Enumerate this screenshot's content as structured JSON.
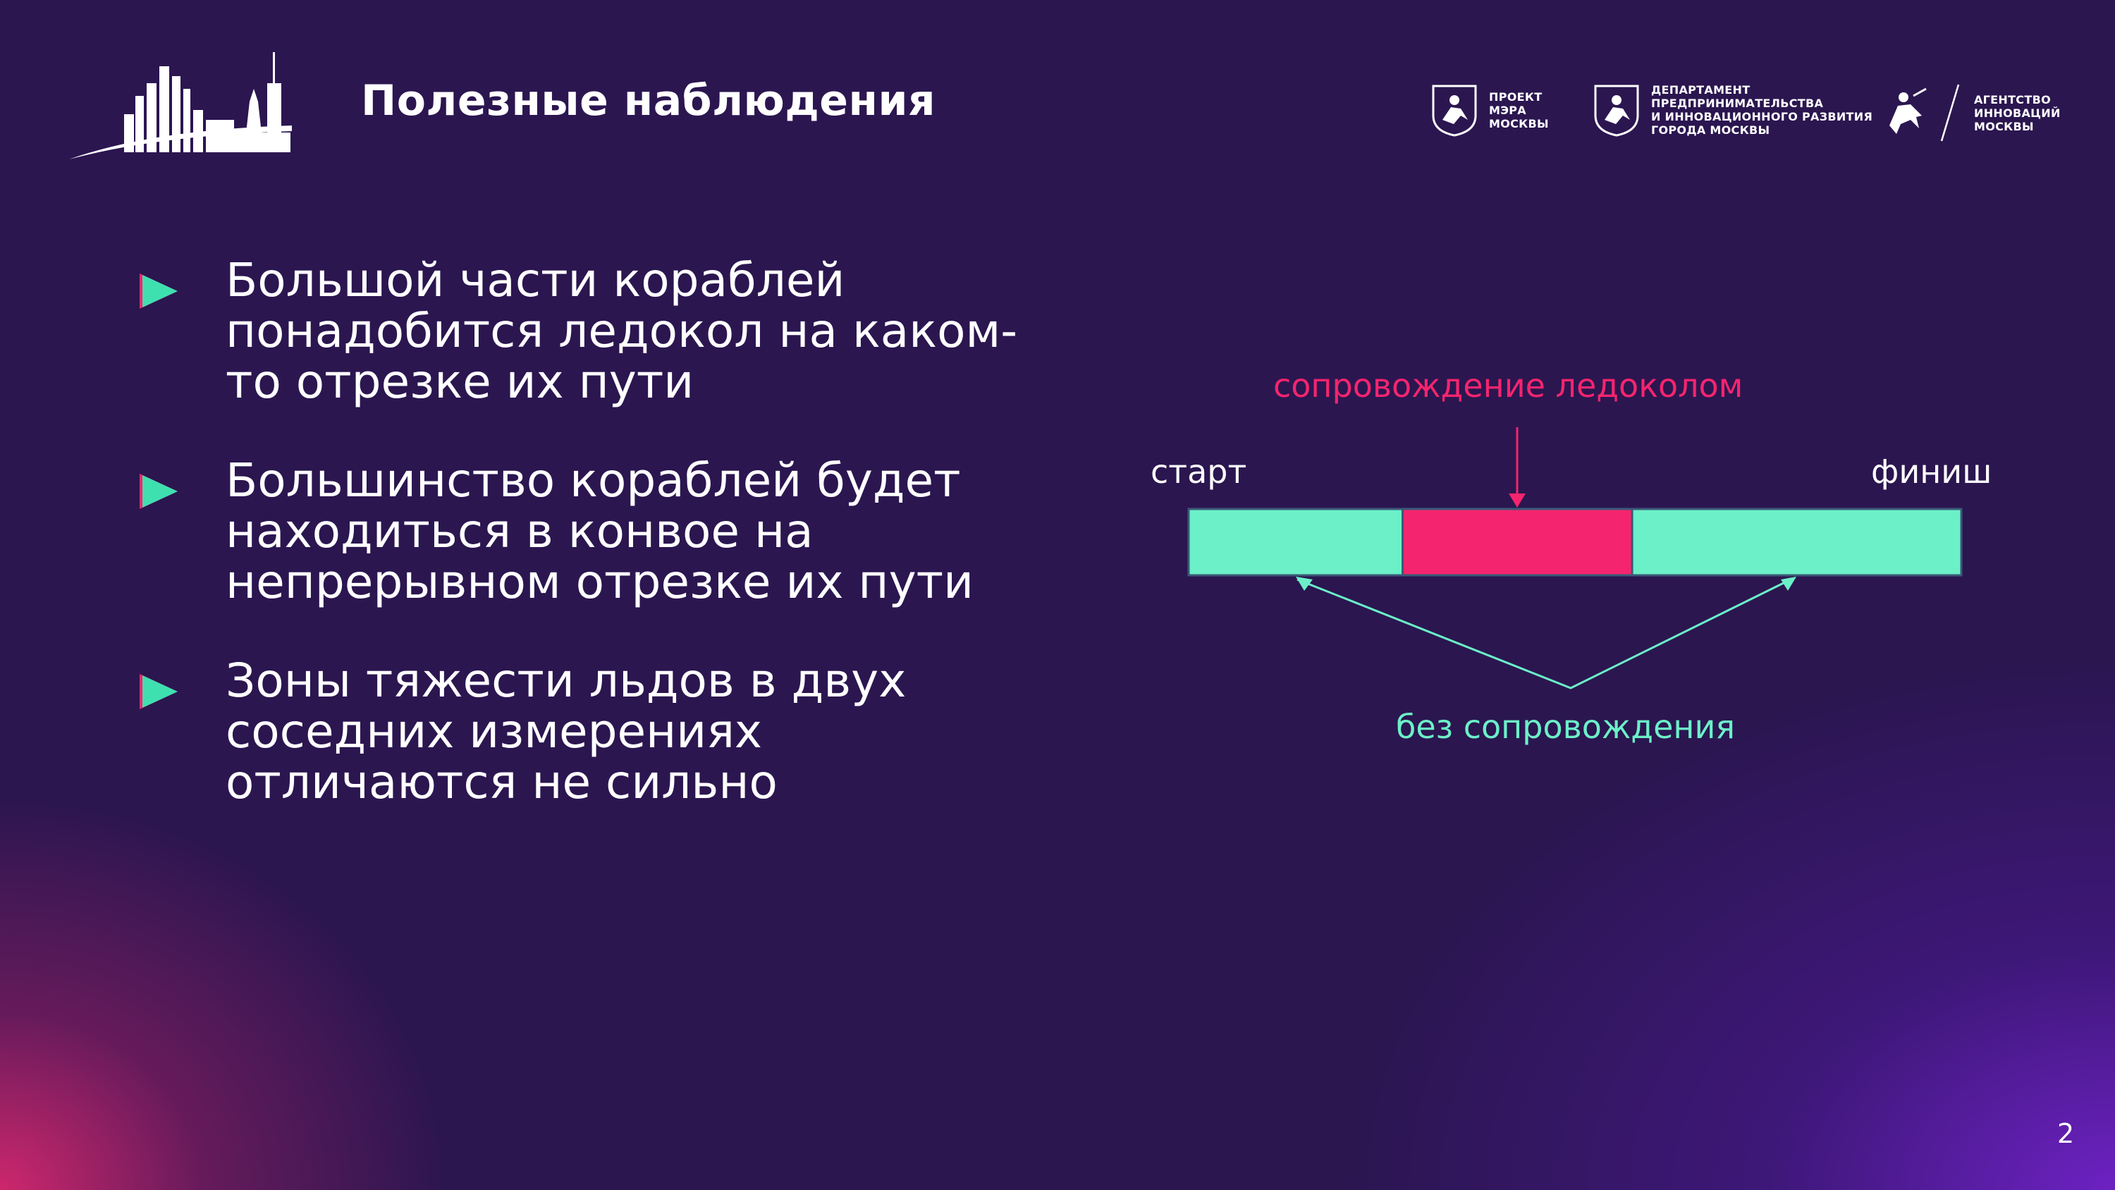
{
  "slide": {
    "title": "Полезные наблюдения",
    "page_number": "2"
  },
  "logos": [
    {
      "icon": "moscow-emblem-icon",
      "text": "ПРОЕКТ\nМЭРА\nМОСКВЫ"
    },
    {
      "icon": "moscow-emblem-icon",
      "text": "ДЕПАРТАМЕНТ\nПРЕДПРИНИМАТЕЛЬСТВА\nИ ИННОВАЦИОННОГО РАЗВИТИЯ\nГОРОДА МОСКВЫ"
    },
    {
      "icon": "st-george-icon",
      "text": "АГЕНТСТВО\nИННОВАЦИЙ\nМОСКВЫ"
    }
  ],
  "bullets": [
    "Большой части кораблей\nпонадобится ледокол на каком-\nто отрезке их пути",
    "Большинство кораблей будет\nнаходиться в конвое на\nнепрерывном отрезке их пути",
    "Зоны тяжести льдов в двух\nсоседних измерениях\nотличаются не сильно"
  ],
  "diagram": {
    "escort_label": "сопровождение ледоколом",
    "start_label": "старт",
    "finish_label": "финиш",
    "no_escort_label": "без сопровождения",
    "segments": [
      {
        "name": "no-escort",
        "start_fraction": 0.0,
        "end_fraction": 0.277
      },
      {
        "name": "escort",
        "start_fraction": 0.277,
        "end_fraction": 0.574
      },
      {
        "name": "no-escort",
        "start_fraction": 0.574,
        "end_fraction": 1.0
      }
    ]
  },
  "colors": {
    "background": "#2b1650",
    "accent_pink": "#f5246e",
    "accent_mint": "#6cf0c8"
  }
}
